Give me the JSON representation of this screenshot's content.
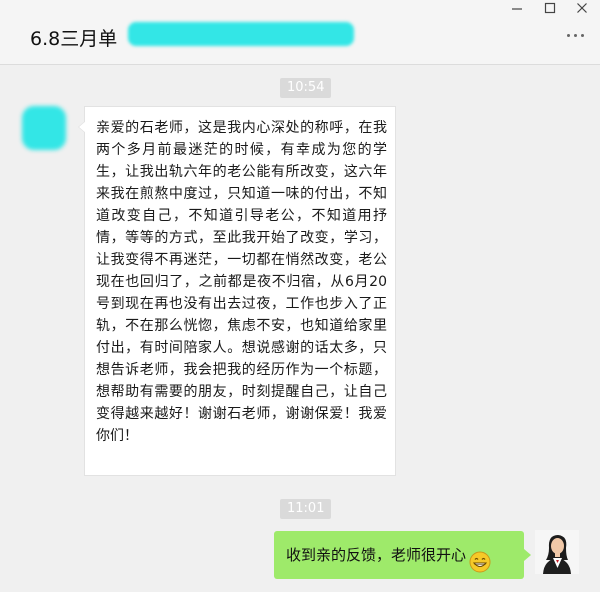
{
  "header": {
    "title": "6.8三月单",
    "more_icon": "more-icon"
  },
  "window_controls": {
    "minimize_icon": "minimize-icon",
    "maximize_icon": "maximize-icon",
    "close_icon": "close-icon"
  },
  "messages": [
    {
      "time": "10:54",
      "sender": "other",
      "text": "亲爱的石老师，这是我内心深处的称呼，在我两个多月前最迷茫的时候，有幸成为您的学生，让我出轨六年的老公能有所改变，这六年来我在煎熬中度过，只知道一味的付出，不知道改变自己，不知道引导老公，不知道用抒情，等等的方式，至此我开始了改变，学习，让我变得不再迷茫，一切都在悄然改变，老公现在也回归了，之前都是夜不归宿，从6月20号到现在再也没有出去过夜，工作也步入了正轨，不在那么恍惚，焦虑不安，也知道给家里付出，有时间陪家人。想说感谢的话太多，只想告诉老师，我会把我的经历作为一个标题，想帮助有需要的朋友，时刻提醒自己，让自己变得越来越好！谢谢石老师，谢谢保爱！我爱你们！"
    },
    {
      "time": "11:01",
      "sender": "self",
      "text": "收到亲的反馈，老师很开心",
      "emoji": "grin-emoji"
    }
  ],
  "colors": {
    "self_bubble": "#9eea6a",
    "other_bubble": "#ffffff",
    "redaction": "#33e6e6"
  }
}
